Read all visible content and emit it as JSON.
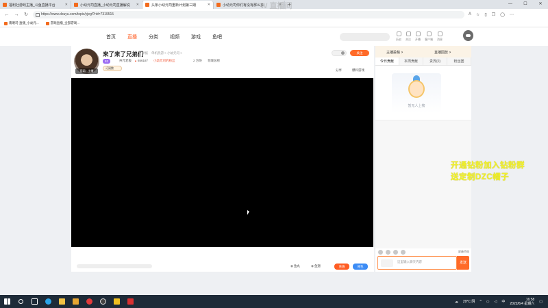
{
  "browser": {
    "tabs": [
      {
        "title": "福利社游戏主播_斗鱼直播平台",
        "active": false
      },
      {
        "title": "小幼元司直播_小幼元司直播解说",
        "active": false
      },
      {
        "title": "头条小幼元司重新计划第三期",
        "active": true
      },
      {
        "title": "小幼元司你们有没有那么多",
        "active": false
      }
    ],
    "url": "https://www.douyu.com/topic/yjegf?rid=7319515",
    "bookmarks": [
      "南明司-直播_小幼元...",
      "游戏直播_全部游戏..."
    ]
  },
  "site": {
    "nav": [
      "首页",
      "直播",
      "分类",
      "视频",
      "游戏",
      "鱼吧"
    ],
    "active_nav": "直播",
    "header_icons": [
      "历史",
      "关注",
      "开播",
      "客户端",
      "消息"
    ]
  },
  "room": {
    "avatar_tag": "官网 · 主播",
    "title": "来了来了兄弟们",
    "report": "举报",
    "category": "单机热游 > 小幼元司 >",
    "level": "53",
    "anchor": "升元老板",
    "hot": "656187",
    "fanclub": "小幼元司的粉丝",
    "fans": "2 方呀",
    "rank": "领域总榜",
    "follow": "订阅数",
    "subscribe": "关注",
    "share": "分享",
    "tip": "爆料游戏",
    "controls": {
      "a": "鱼丸",
      "b": "鱼翅",
      "send_orange": "充值",
      "send_blue": "背包"
    }
  },
  "chat": {
    "top_left": "主播投稿 >",
    "top_right": "直播回放 >",
    "tabs": [
      "今日贡献",
      "本周贡献",
      "贵宾(0)",
      "粉丝团"
    ],
    "empty_caption": "暂无人上榜",
    "lock_label": "屏蔽特效",
    "input_placeholder": "这里输入聊天内容",
    "send": "发送"
  },
  "overlay": {
    "watermark": "W 直播间",
    "promo_line1": "开通钻粉加入钻粉群",
    "promo_line2": "送定制DZC帽子"
  },
  "taskbar": {
    "weather": "29°C 阴",
    "time": "16:58",
    "date": "2022/6/4 星期六"
  },
  "colors": {
    "accent": "#ff5d23",
    "promo": "#f1f12b",
    "taskbar": "#1e2b38"
  }
}
